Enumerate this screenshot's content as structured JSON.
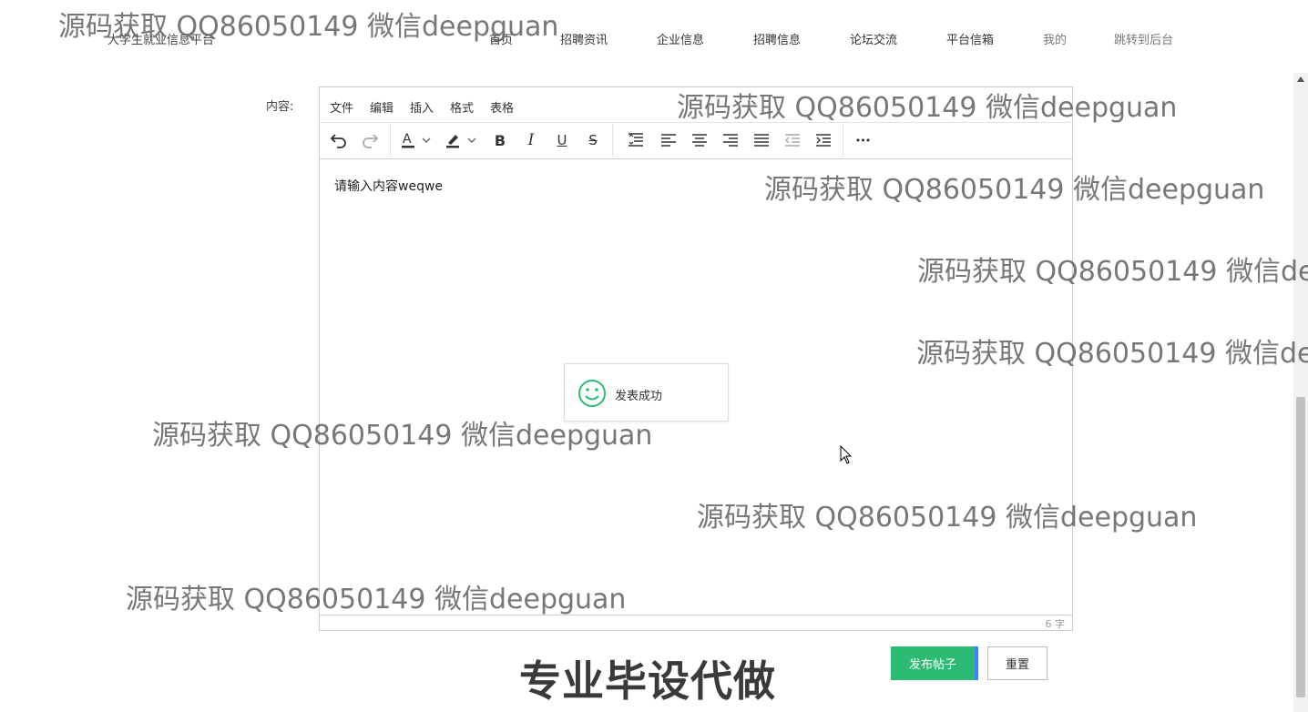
{
  "header": {
    "brand": "大学生就业信息平台",
    "nav": [
      "首页",
      "招聘资讯",
      "企业信息",
      "招聘信息",
      "论坛交流",
      "平台信箱",
      "我的",
      "跳转到后台"
    ]
  },
  "form": {
    "content_label": "内容:"
  },
  "editor": {
    "menus": [
      "文件",
      "编辑",
      "插入",
      "格式",
      "表格"
    ],
    "toolbar_icons": [
      "undo-icon",
      "redo-icon",
      "text-color-icon",
      "highlight-color-icon",
      "bold-icon",
      "italic-icon",
      "underline-icon",
      "strikethrough-icon",
      "line-height-icon",
      "align-left-icon",
      "align-center-icon",
      "align-right-icon",
      "align-justify-icon",
      "outdent-icon",
      "indent-icon",
      "more-icon"
    ],
    "toolbar_glyphs": {
      "bold": "B",
      "italic": "I",
      "underline": "U",
      "strike": "S",
      "more": "•••"
    },
    "content": "请输入内容weqwe",
    "word_count": "6 字"
  },
  "toast": {
    "message": "发表成功",
    "icon": "smile-icon",
    "color": "#2dbb73"
  },
  "actions": {
    "publish_label": "发布帖子",
    "reset_label": "重置",
    "publish_color": "#2dbb73"
  },
  "watermark": {
    "text": "源码获取 QQ86050149 微信deepguan",
    "promo": "专业毕设代做"
  }
}
